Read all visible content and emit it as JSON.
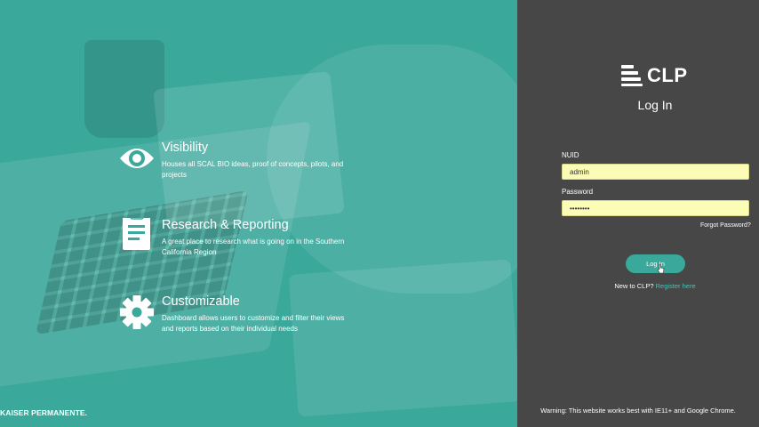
{
  "hero": {
    "features": [
      {
        "icon": "eye-icon",
        "title": "Visibility",
        "description": "Houses all SCAL BIO ideas, proof of concepts, pilots, and projects"
      },
      {
        "icon": "clipboard-icon",
        "title": "Research & Reporting",
        "description": "A great place to research what is going on in the Southern California Region"
      },
      {
        "icon": "gear-icon",
        "title": "Customizable",
        "description": "Dashboard allows users to customize and filter their views and reports based on their individual needs"
      }
    ],
    "brand": "KAISER PERMANENTE."
  },
  "login": {
    "logo_text": "CLP",
    "title": "Log In",
    "nuid_label": "NUID",
    "nuid_value": "admin",
    "password_label": "Password",
    "password_value": "secretpw",
    "forgot_label": "Forgot Password?",
    "button_label": "Log In",
    "register_prompt": "New to CLP?",
    "register_link": "Register here",
    "warning": "Warning: This website works best with IE11+ and Google Chrome."
  },
  "colors": {
    "accent": "#3aa89a",
    "panel_bg": "#474747",
    "input_bg": "#fbfcb6",
    "link": "#46c4b3"
  }
}
